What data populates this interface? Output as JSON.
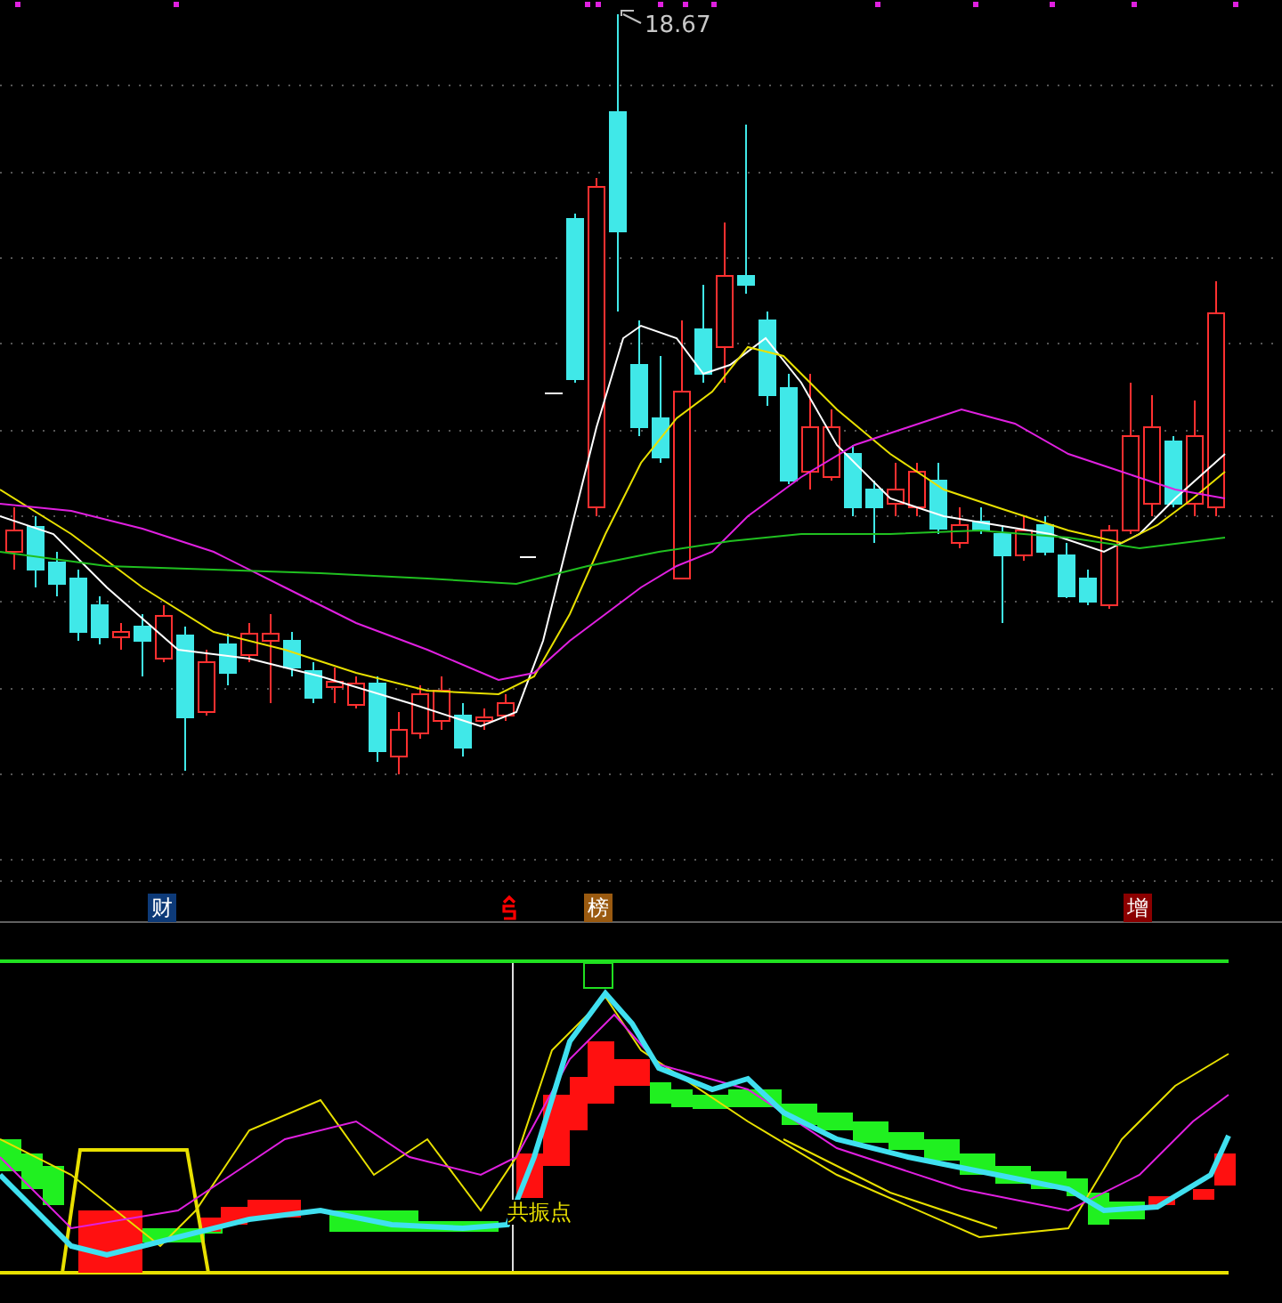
{
  "price_chart": {
    "peak_label": "18.67"
  },
  "event_markers": [
    {
      "kind": "badge",
      "label": "财",
      "color": "#0d3a78"
    },
    {
      "kind": "symbol",
      "color": "#ff0000"
    },
    {
      "kind": "badge",
      "label": "榜",
      "color": "#9a5a10"
    },
    {
      "kind": "badge",
      "label": "增",
      "color": "#8b0000"
    }
  ],
  "indicator_chart": {
    "signal_label": "共振点"
  }
}
